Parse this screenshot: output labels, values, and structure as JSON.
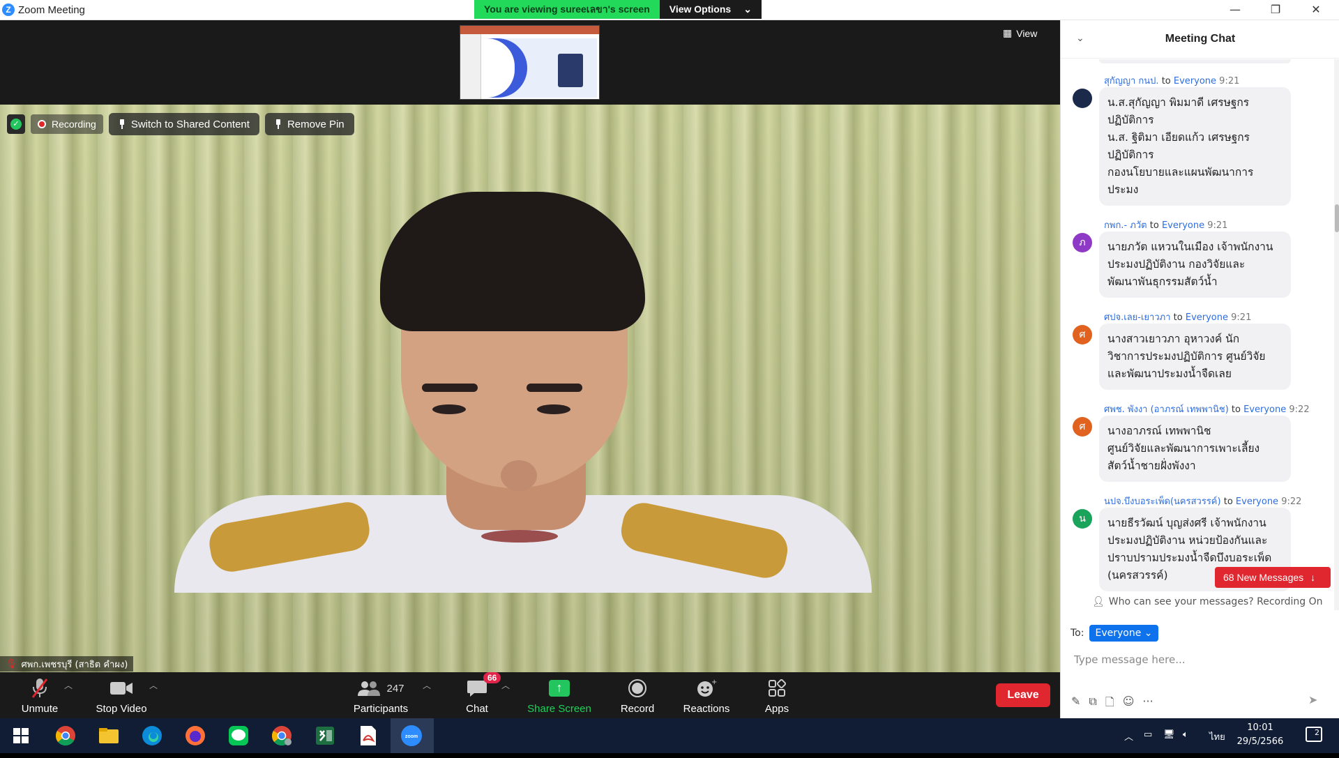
{
  "window": {
    "title": "Zoom Meeting",
    "app_icon": "Z",
    "controls": [
      "minimize-icon",
      "restore-icon",
      "close-icon"
    ]
  },
  "share_banner": {
    "viewing_text": "You are viewing sureeเลขา's screen",
    "view_options_label": "View Options",
    "color_green": "#23d959"
  },
  "top_strip": {
    "view_label": "View"
  },
  "video_overlay": {
    "recording_label": "Recording",
    "switch_label": "Switch to Shared Content",
    "remove_pin_label": "Remove Pin",
    "participant_name": "ศพก.เพชรบุรี (สาธิต คำผง)"
  },
  "toolbar": {
    "unmute_label": "Unmute",
    "stop_video_label": "Stop Video",
    "participants_label": "Participants",
    "participants_count": "247",
    "chat_label": "Chat",
    "chat_badge": "66",
    "share_screen_label": "Share Screen",
    "record_label": "Record",
    "reactions_label": "Reactions",
    "apps_label": "Apps",
    "leave_label": "Leave"
  },
  "chat": {
    "title": "Meeting Chat",
    "new_messages_label": "68 New Messages",
    "who_can_see": "Who can see your messages? Recording On",
    "to_label": "To:",
    "to_value": "Everyone",
    "input_placeholder": "Type message here...",
    "messages": [
      {
        "sender": "สุกัญญา กนป.",
        "to_word": "to",
        "recipient": "Everyone",
        "time": "9:21",
        "avatar_letter": "",
        "avatar_color": "#1b2a4a",
        "lines": [
          "น.ส.สุกัญญา พิมมาดี เศรษฐกร",
          "ปฏิบัติการ",
          "น.ส. ฐิติมา เอียดแก้ว เศรษฐกร",
          "ปฏิบัติการ",
          "กองนโยบายและแผนพัฒนาการ",
          "ประมง"
        ]
      },
      {
        "sender": "กพก.- ภวัต",
        "to_word": "to",
        "recipient": "Everyone",
        "time": "9:21",
        "avatar_letter": "ภ",
        "avatar_color": "#8e3ac6",
        "lines": [
          "นายภวัต แหวนในเมือง เจ้าพนักงาน",
          "ประมงปฏิบัติงาน กองวิจัยและ",
          "พัฒนาพันธุกรรมสัตว์น้ำ"
        ]
      },
      {
        "sender": "ศปจ.เลย-เยาวภา",
        "to_word": "to",
        "recipient": "Everyone",
        "time": "9:21",
        "avatar_letter": "ศ",
        "avatar_color": "#e0621e",
        "lines": [
          "นางสาวเยาวภา อุหาวงค์ นัก",
          "วิชาการประมงปฏิบัติการ  ศูนย์วิจัย",
          "และพัฒนาประมงน้ำจืดเลย"
        ]
      },
      {
        "sender": "ศพช. พังงา (อาภรณ์ เทพพานิช)",
        "to_word": "to",
        "recipient": "Everyone",
        "time": "9:22",
        "avatar_letter": "ศ",
        "avatar_color": "#e0621e",
        "lines": [
          "นางอาภรณ์ เทพพานิช",
          "ศูนย์วิจัยและพัฒนาการเพาะเลี้ยง",
          "สัตว์น้ำชายฝั่งพังงา"
        ]
      },
      {
        "sender": "นปจ.บึงบอระเพ็ด(นครสวรรค์)",
        "to_word": "to",
        "recipient": "Everyone",
        "time": "9:22",
        "avatar_letter": "น",
        "avatar_color": "#1aa35a",
        "lines": [
          "นายธีรวัฒน์ บุญส่งศรี เจ้าพนักงาน",
          "ประมงปฏิบัติงาน หน่วยป้องกันและ",
          "ปราบปรามประมงน้ำจืดบึงบอระเพ็ด",
          "(นครสวรรค์)"
        ]
      }
    ]
  },
  "taskbar": {
    "apps": [
      "windows-start-icon",
      "chrome-icon",
      "file-explorer-icon",
      "edge-icon",
      "firefox-icon",
      "line-icon",
      "chrome-profile-icon",
      "excel-icon",
      "acrobat-icon",
      "zoom-icon"
    ],
    "language": "ไทย",
    "time": "10:01",
    "date": "29/5/2566",
    "notification_count": "2"
  }
}
